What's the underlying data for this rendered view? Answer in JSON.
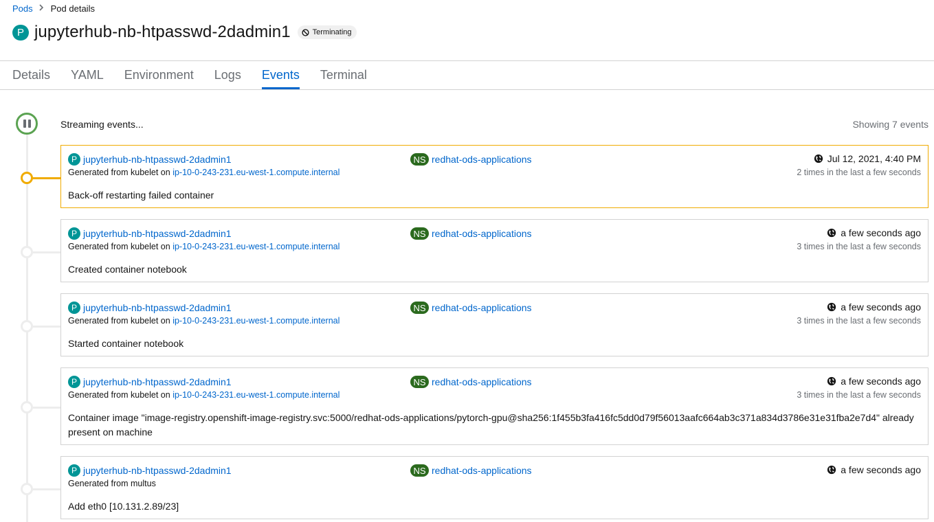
{
  "breadcrumb": {
    "parent": "Pods",
    "current": "Pod details"
  },
  "header": {
    "badge": "P",
    "title": "jupyterhub-nb-htpasswd-2dadmin1",
    "status": "Terminating"
  },
  "tabs": [
    {
      "label": "Details"
    },
    {
      "label": "YAML"
    },
    {
      "label": "Environment"
    },
    {
      "label": "Logs"
    },
    {
      "label": "Events"
    },
    {
      "label": "Terminal"
    }
  ],
  "active_tab": "Events",
  "stream": {
    "label": "Streaming events...",
    "count": "Showing 7 events"
  },
  "events": [
    {
      "obj_badge": "P",
      "obj_name": "jupyterhub-nb-htpasswd-2dadmin1",
      "ns_badge": "NS",
      "ns_name": "redhat-ods-applications",
      "time": "Jul 12, 2021, 4:40 PM",
      "source_prefix": "Generated from kubelet on ",
      "source_host": "ip-10-0-243-231.eu-west-1.compute.internal",
      "count": "2 times in the last a few seconds",
      "message": "Back-off restarting failed container",
      "warning": true
    },
    {
      "obj_badge": "P",
      "obj_name": "jupyterhub-nb-htpasswd-2dadmin1",
      "ns_badge": "NS",
      "ns_name": "redhat-ods-applications",
      "time": "a few seconds ago",
      "source_prefix": "Generated from kubelet on ",
      "source_host": "ip-10-0-243-231.eu-west-1.compute.internal",
      "count": "3 times in the last a few seconds",
      "message": "Created container notebook",
      "warning": false
    },
    {
      "obj_badge": "P",
      "obj_name": "jupyterhub-nb-htpasswd-2dadmin1",
      "ns_badge": "NS",
      "ns_name": "redhat-ods-applications",
      "time": "a few seconds ago",
      "source_prefix": "Generated from kubelet on ",
      "source_host": "ip-10-0-243-231.eu-west-1.compute.internal",
      "count": "3 times in the last a few seconds",
      "message": "Started container notebook",
      "warning": false
    },
    {
      "obj_badge": "P",
      "obj_name": "jupyterhub-nb-htpasswd-2dadmin1",
      "ns_badge": "NS",
      "ns_name": "redhat-ods-applications",
      "time": "a few seconds ago",
      "source_prefix": "Generated from kubelet on ",
      "source_host": "ip-10-0-243-231.eu-west-1.compute.internal",
      "count": "3 times in the last a few seconds",
      "message": "Container image \"image-registry.openshift-image-registry.svc:5000/redhat-ods-applications/pytorch-gpu@sha256:1f455b3fa416fc5dd0d79f56013aafc664ab3c371a834d3786e31e31fba2e7d4\" already present on machine",
      "warning": false
    },
    {
      "obj_badge": "P",
      "obj_name": "jupyterhub-nb-htpasswd-2dadmin1",
      "ns_badge": "NS",
      "ns_name": "redhat-ods-applications",
      "time": "a few seconds ago",
      "source_prefix": "Generated from multus",
      "source_host": "",
      "count": "",
      "message": "Add eth0 [10.131.2.89/23]",
      "warning": false
    }
  ],
  "colors": {
    "link": "#0066cc",
    "pod_badge": "#009596",
    "ns_badge": "#2b6a1e",
    "warning": "#f0ab00",
    "stream_active": "#5ba352"
  },
  "icons": [
    "chevron-right-icon",
    "ban-icon",
    "pause-icon",
    "globe-icon"
  ]
}
